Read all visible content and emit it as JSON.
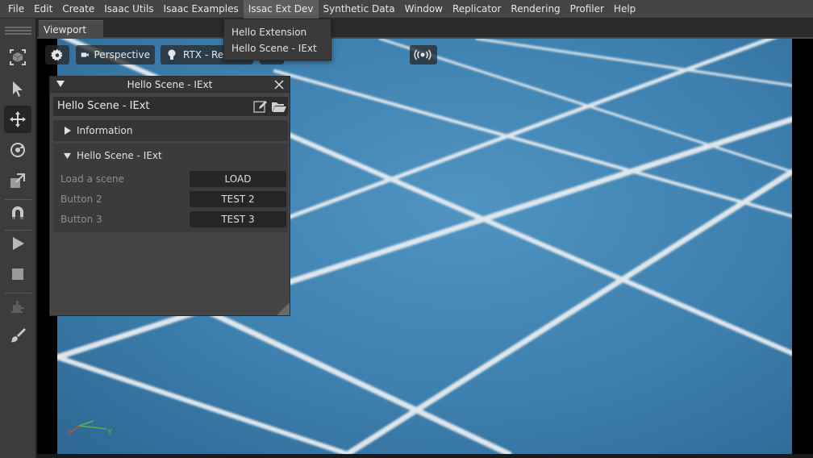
{
  "menubar": {
    "items": [
      {
        "label": "File"
      },
      {
        "label": "Edit"
      },
      {
        "label": "Create"
      },
      {
        "label": "Isaac Utils"
      },
      {
        "label": "Isaac Examples"
      },
      {
        "label": "Issac Ext Dev"
      },
      {
        "label": "Synthetic Data"
      },
      {
        "label": "Window"
      },
      {
        "label": "Replicator"
      },
      {
        "label": "Rendering"
      },
      {
        "label": "Profiler"
      },
      {
        "label": "Help"
      }
    ],
    "active_index": 5
  },
  "dropdown": {
    "items": [
      {
        "label": "Hello Extension"
      },
      {
        "label": "Hello Scene - IExt"
      }
    ]
  },
  "toolbar": {
    "tools": [
      {
        "icon": "select-mode-icon"
      },
      {
        "icon": "select-arrow-icon"
      },
      {
        "icon": "move-icon"
      },
      {
        "icon": "rotate-icon"
      },
      {
        "icon": "scale-icon"
      },
      {
        "icon": "snap-magnet-icon"
      },
      {
        "icon": "play-icon"
      },
      {
        "icon": "stop-icon"
      },
      {
        "icon": "robot-icon"
      },
      {
        "icon": "paint-brush-icon"
      }
    ],
    "active_tool": "move-icon"
  },
  "viewport": {
    "tab_label": "Viewport",
    "camera_label": "Perspective",
    "render_label": "RTX - Real",
    "ground_color": "#3f82b0",
    "grid_line_color": "#e8ecef"
  },
  "panel": {
    "title": "Hello Scene - IExt",
    "header_title": "Hello Scene - IExt",
    "sections": [
      {
        "label": "Information",
        "expanded": false
      },
      {
        "label": "Hello Scene - IExt",
        "expanded": true
      }
    ],
    "rows": [
      {
        "label": "Load a scene",
        "button": "LOAD"
      },
      {
        "label": "Button 2",
        "button": "TEST 2"
      },
      {
        "label": "Button 3",
        "button": "TEST 3"
      }
    ]
  },
  "axis": {
    "x_label": "X",
    "y_label": "Y",
    "x_color": "#c84a3c",
    "y_color": "#5fae4a"
  }
}
